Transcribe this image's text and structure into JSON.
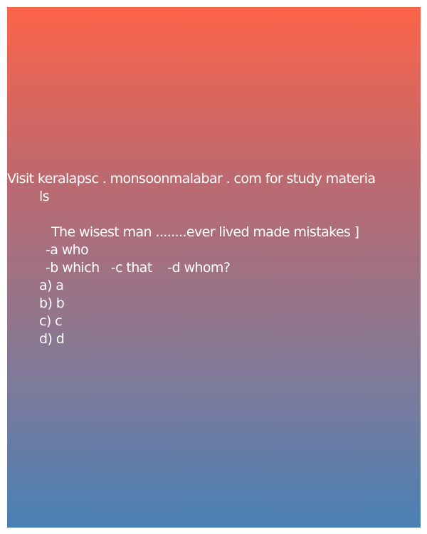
{
  "header": {
    "line1": "Visit keralapsc . monsoonmalabar . com for study materia",
    "line2": "ls"
  },
  "question": {
    "text": "The wisest man ........ever lived made mistakes ]",
    "option_row1": "-a who",
    "option_row2": "-b which   -c that    -d whom?"
  },
  "answers": [
    "a) a",
    "b) b",
    "c) c",
    "d) d"
  ],
  "colors": {
    "gradient_top": "#fc6449",
    "gradient_bottom": "#4a80b3",
    "text": "#ffffff",
    "page_border": "#ffffff"
  }
}
